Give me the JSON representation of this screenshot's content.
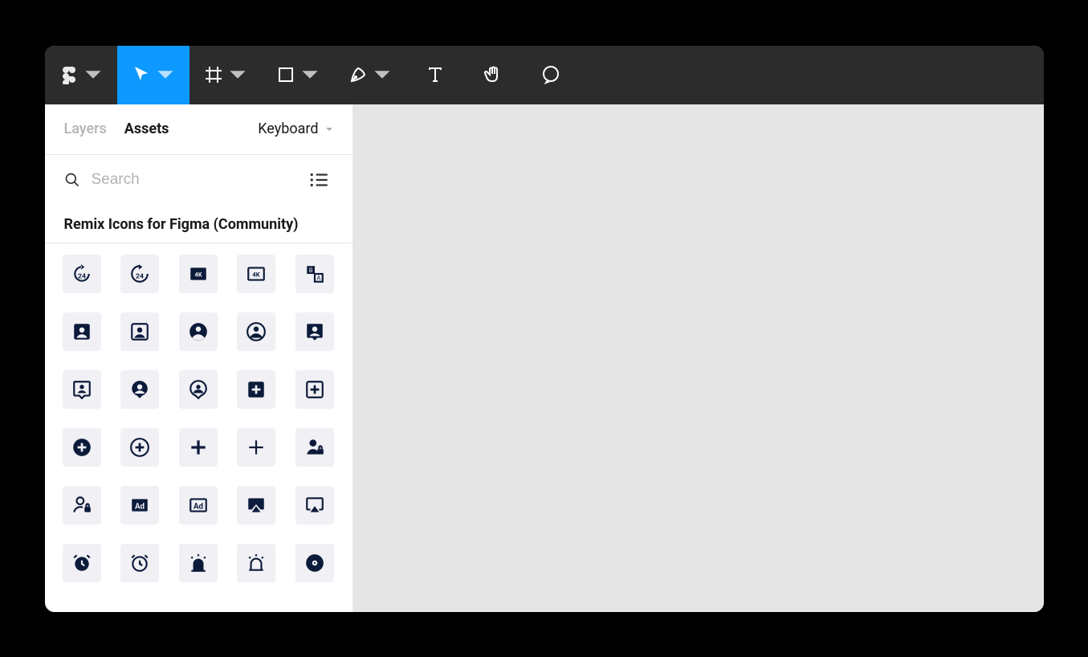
{
  "colors": {
    "accent": "#0d99ff",
    "toolbar": "#2c2c2c",
    "icon": "#0c1b3a"
  },
  "tabs": {
    "layers": "Layers",
    "assets": "Assets",
    "active": "assets"
  },
  "page_selector": "Keyboard",
  "search": {
    "placeholder": "Search",
    "value": ""
  },
  "section_title": "Remix Icons for Figma (Community)",
  "toolbar_tools": [
    {
      "name": "figma-menu",
      "hasChevron": true
    },
    {
      "name": "move-tool",
      "hasChevron": true,
      "active": true
    },
    {
      "name": "frame-tool",
      "hasChevron": true
    },
    {
      "name": "rectangle-tool",
      "hasChevron": true
    },
    {
      "name": "pen-tool",
      "hasChevron": true
    },
    {
      "name": "text-tool",
      "hasChevron": false
    },
    {
      "name": "hand-tool",
      "hasChevron": false
    },
    {
      "name": "comment-tool",
      "hasChevron": false
    }
  ],
  "assets": [
    "24-hours-fill",
    "24-hours-line",
    "4k-fill",
    "4k-line",
    "a-b-translate",
    "account-box-fill",
    "account-box-line",
    "account-circle-fill",
    "account-circle-line",
    "account-pin-box-fill",
    "account-pin-box-line",
    "account-pin-circle-fill",
    "account-pin-circle-line",
    "add-box-fill",
    "add-box-line",
    "add-circle-fill",
    "add-circle-line",
    "add-fill",
    "add-line",
    "admin-fill",
    "admin-line",
    "advertisement-fill",
    "advertisement-line",
    "airplay-fill",
    "airplay-line",
    "alarm-fill",
    "alarm-line",
    "alarm-warning-fill",
    "alarm-warning-line",
    "album-fill"
  ]
}
